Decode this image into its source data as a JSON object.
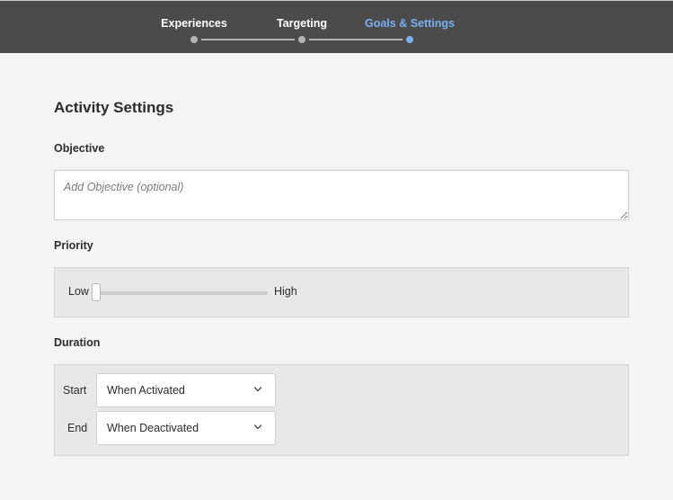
{
  "stepper": {
    "steps": [
      {
        "label": "Experiences",
        "state": "completed"
      },
      {
        "label": "Targeting",
        "state": "completed"
      },
      {
        "label": "Goals & Settings",
        "state": "active"
      }
    ],
    "colors": {
      "bar": "#4b4b4b",
      "active": "#79aef0",
      "inactive": "#b3b3b3"
    }
  },
  "main": {
    "title": "Activity Settings",
    "objective": {
      "label": "Objective",
      "placeholder": "Add Objective (optional)",
      "value": ""
    },
    "priority": {
      "label": "Priority",
      "low_label": "Low",
      "high_label": "High",
      "level": 0
    },
    "duration": {
      "label": "Duration",
      "start_label": "Start",
      "start_value": "When Activated",
      "end_label": "End",
      "end_value": "When Deactivated"
    }
  },
  "icons": {
    "chevron": "chevron-down-icon"
  }
}
